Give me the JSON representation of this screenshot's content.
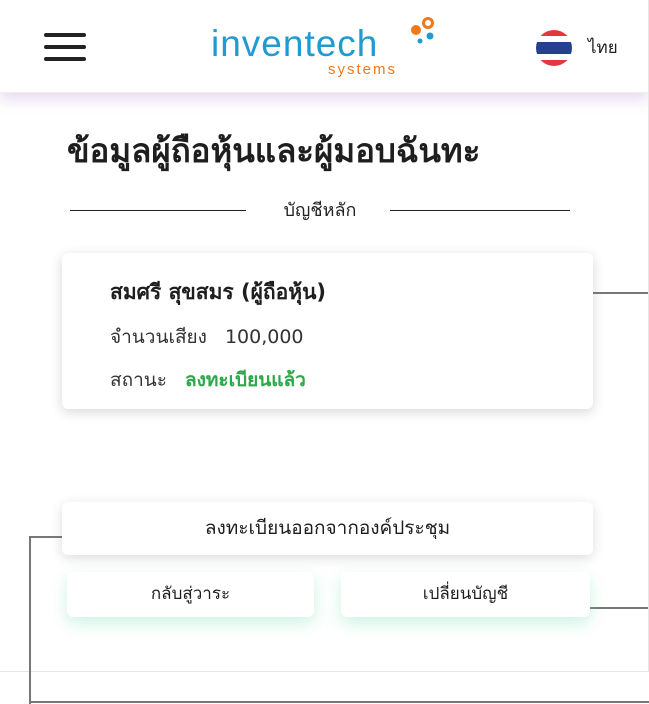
{
  "header": {
    "logo_main": "inventech",
    "logo_sub": "systems",
    "language_label": "ไทย",
    "colors": {
      "logo_blue": "#1f9bd1",
      "logo_orange": "#f07a1a"
    }
  },
  "page": {
    "title": "ข้อมูลผู้ถือหุ้นและผู้มอบฉันทะ",
    "section_label": "บัญชีหลัก"
  },
  "account_card": {
    "name": "สมศรี สุขสมร (ผู้ถือหุ้น)",
    "votes_label": "จำนวนเสียง",
    "votes_value": "100,000",
    "status_label": "สถานะ",
    "status_value": "ลงทะเบียนแล้ว",
    "status_color": "#2ea84a"
  },
  "actions": {
    "unregister_label": "ลงทะเบียนออกจากองค์ประชุม",
    "back_label": "กลับสู่วาระ",
    "switch_account_label": "เปลี่ยนบัญชี"
  }
}
